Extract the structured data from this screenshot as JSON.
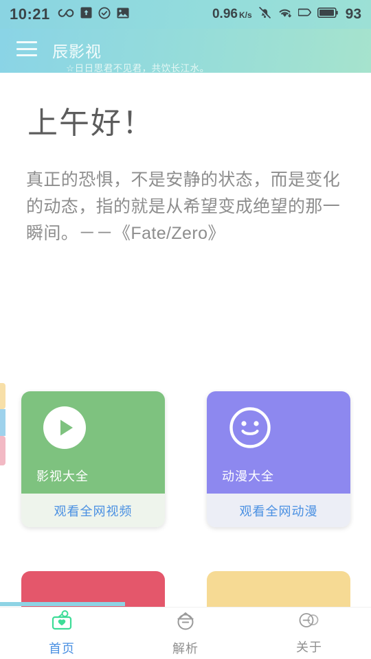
{
  "statusbar": {
    "time": "10:21",
    "left_icons": [
      "infinity-icon",
      "upload-box-icon",
      "check-circle-icon",
      "image-icon"
    ],
    "network_speed": "0.96",
    "network_speed_unit": "K/s",
    "right_icons": [
      "bell-muted-icon",
      "wifi-icon",
      "sim-icon",
      "battery-icon"
    ],
    "battery_level": "93"
  },
  "header": {
    "menu_icon": "hamburger-menu-icon",
    "title": "辰影视",
    "subtitle": "☆日日思君不见君，共饮长江水。"
  },
  "main": {
    "greeting": "上午好！",
    "quote": "真正的恐惧，不是安静的状态，而是变化的动态，指的就是从希望变成绝望的那一瞬间。－－《Fate/Zero》",
    "cards": [
      {
        "id": "movies",
        "label": "影视大全",
        "footer": "观看全网视频",
        "icon": "play-circle-icon",
        "color": "#7ec27f",
        "footer_color": "#eef4ec"
      },
      {
        "id": "anime",
        "label": "动漫大全",
        "footer": "观看全网动漫",
        "icon": "smiley-face-icon",
        "color": "#8d88ef",
        "footer_color": "#eceef6"
      }
    ],
    "peek_cards": [
      {
        "id": "red",
        "color": "#e4576b"
      },
      {
        "id": "yellow",
        "color": "#f6da94"
      }
    ],
    "edge_slivers": [
      "#f7dfa8",
      "#9ed2ec",
      "#f2b9c4"
    ]
  },
  "bottomnav": {
    "active_color": "#4a90e2",
    "items": [
      {
        "label": "首页",
        "icon": "home-box-heart-icon",
        "active": true
      },
      {
        "label": "解析",
        "icon": "parse-circle-icon",
        "active": false
      },
      {
        "label": "关于",
        "icon": "two-circles-icon",
        "active": false
      }
    ]
  }
}
